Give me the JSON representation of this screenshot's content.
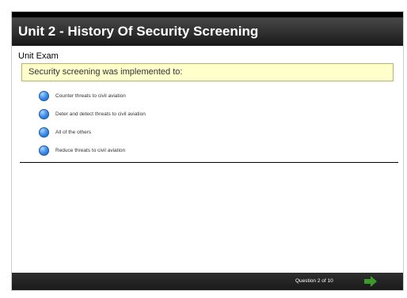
{
  "header": {
    "title": "Unit 2 - History Of Security Screening"
  },
  "exam": {
    "subtitle": "Unit Exam",
    "question": "Security screening was implemented to:",
    "options": [
      {
        "label": "Counter threats to civil aviation"
      },
      {
        "label": "Deter and detect threats to civil aviation"
      },
      {
        "label": "All of the others"
      },
      {
        "label": "Reduce threats to civil aviation"
      }
    ]
  },
  "footer": {
    "counter": "Question 2 of 10",
    "next_icon": "right-arrow-icon",
    "next_color": "#3a9a2a"
  },
  "colors": {
    "title_bar": "#2f2f2f",
    "question_box_bg": "#ffffcc",
    "radio": "#3e8ee8"
  }
}
